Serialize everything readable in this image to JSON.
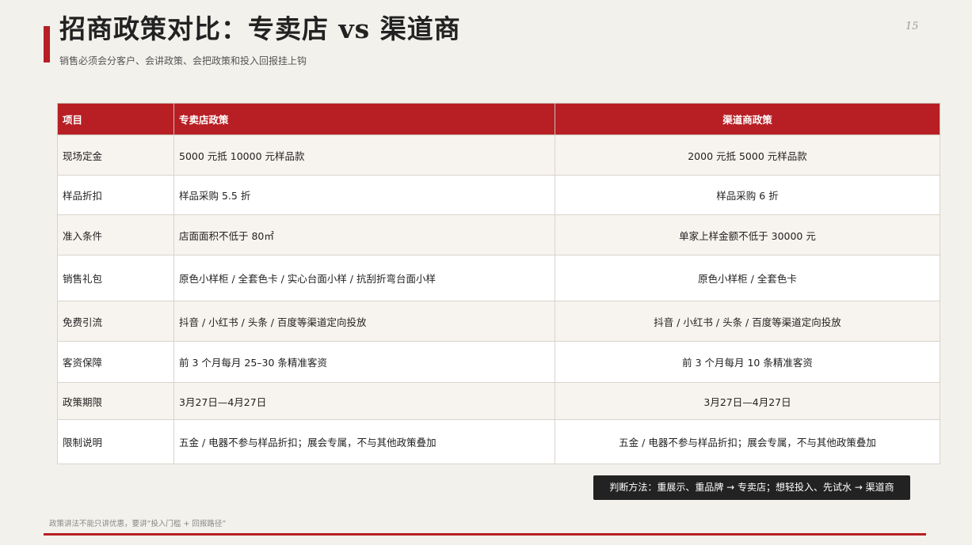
{
  "slide": {
    "title": "招商政策对比：专卖店 vs 渠道商",
    "subtitle": "销售必须会分客户、会讲政策、会把政策和投入回报挂上钩",
    "page_number": "15",
    "accent_color": "#b71f24"
  },
  "table": {
    "headers": [
      "项目",
      "专卖店政策",
      "渠道商政策"
    ],
    "rows": [
      [
        "现场定金",
        "5000 元抵 10000 元样品款",
        "2000 元抵 5000 元样品款"
      ],
      [
        "样品折扣",
        "样品采购 5.5 折",
        "样品采购 6 折"
      ],
      [
        "准入条件",
        "店面面积不低于 80㎡",
        "单家上样金额不低于 30000 元"
      ],
      [
        "销售礼包",
        "原色小样柜 / 全套色卡 / 实心台面小样 / 抗刮折弯台面小样",
        "原色小样柜 / 全套色卡"
      ],
      [
        "免费引流",
        "抖音 / 小红书 / 头条 / 百度等渠道定向投放",
        "抖音 / 小红书 / 头条 / 百度等渠道定向投放"
      ],
      [
        "客资保障",
        "前 3 个月每月 25–30 条精准客资",
        "前 3 个月每月 10 条精准客资"
      ],
      [
        "政策期限",
        "3月27日—4月27日",
        "3月27日—4月27日"
      ],
      [
        "限制说明",
        "五金 / 电器不参与样品折扣；展会专属，不与其他政策叠加",
        "五金 / 电器不参与样品折扣；展会专属，不与其他政策叠加"
      ]
    ]
  },
  "tip_box": {
    "text": "判断方法：重展示、重品牌 → 专卖店；想轻投入、先试水 → 渠道商"
  },
  "footnote": "政策讲法不能只讲优惠，要讲“投入门槛 + 回报路径”"
}
